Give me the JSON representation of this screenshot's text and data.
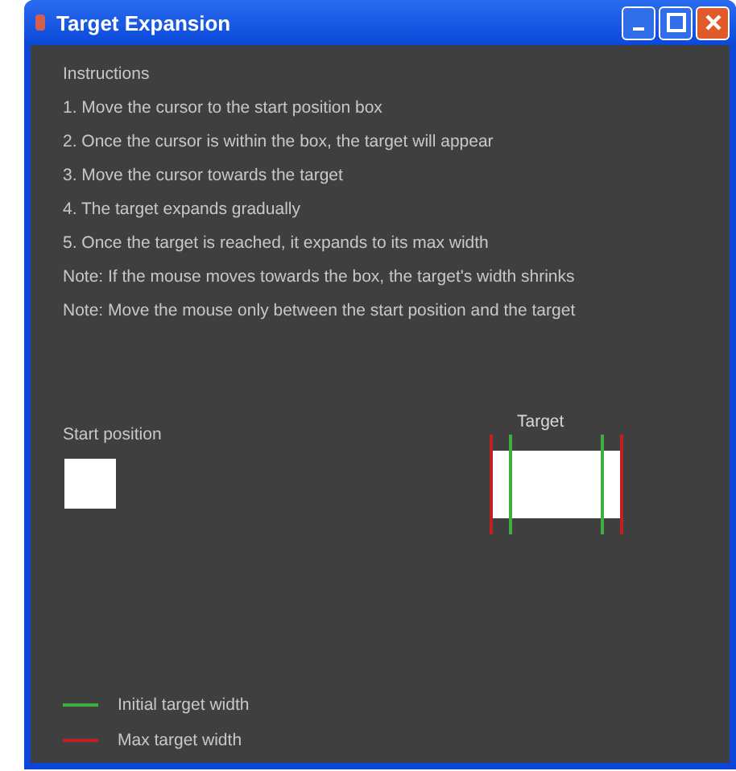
{
  "window": {
    "title": "Target Expansion"
  },
  "instructions": [
    "Instructions",
    "1. Move the cursor to the start position box",
    "2. Once the cursor is within the box, the target will appear",
    "3. Move the cursor towards the target",
    "4. The target expands gradually",
    "5. Once the target is reached, it expands to its max width",
    "Note: If the mouse moves towards the box, the target's width shrinks",
    "Note: Move the mouse only between the start position and the target"
  ],
  "start": {
    "label": "Start position"
  },
  "target": {
    "label": "Target"
  },
  "legend": [
    {
      "label": "Initial target width",
      "color": "#3fae3f"
    },
    {
      "label": "Max target width",
      "color": "#c02020"
    }
  ]
}
